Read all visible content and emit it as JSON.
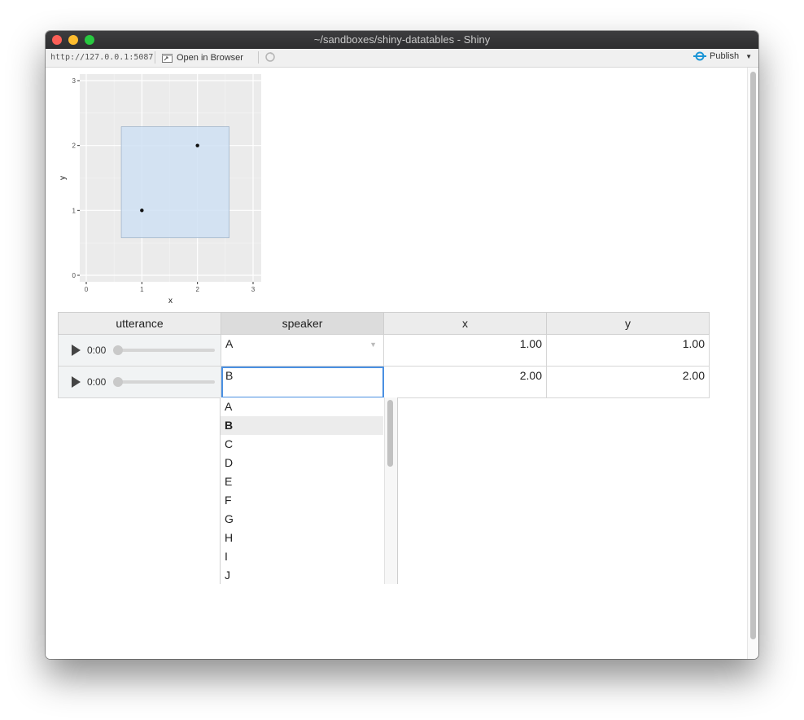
{
  "window": {
    "title": "~/sandboxes/shiny-datatables - Shiny"
  },
  "toolbar": {
    "url": "http://127.0.0.1:5087",
    "open_in_browser": "Open in Browser",
    "publish": "Publish"
  },
  "chart_data": {
    "type": "scatter",
    "xlabel": "x",
    "ylabel": "y",
    "xlim": [
      0,
      3
    ],
    "ylim": [
      0,
      3
    ],
    "x_ticks": [
      "0",
      "1",
      "2",
      "3"
    ],
    "y_ticks": [
      "0",
      "1",
      "2",
      "3"
    ],
    "points": [
      {
        "x": 1,
        "y": 1
      },
      {
        "x": 2,
        "y": 2
      }
    ],
    "highlight_rect": {
      "xmin": 0.63,
      "xmax": 2.57,
      "ymin": 0.58,
      "ymax": 2.29,
      "color": "#cfe0f3"
    },
    "panel_background": "#ebebeb",
    "grid": true
  },
  "table": {
    "headers": [
      "utterance",
      "speaker",
      "x",
      "y"
    ],
    "rows": [
      {
        "time": "0:00",
        "speaker": "A",
        "x": "1.00",
        "y": "1.00"
      },
      {
        "time": "0:00",
        "speaker": "B",
        "x": "2.00",
        "y": "2.00"
      }
    ]
  },
  "dropdown": {
    "options": [
      "A",
      "B",
      "C",
      "D",
      "E",
      "F",
      "G",
      "H",
      "I",
      "J"
    ],
    "selected": "B"
  },
  "colors": {
    "focus": "#4a90e2",
    "publish_icon": "#1a95d6"
  }
}
